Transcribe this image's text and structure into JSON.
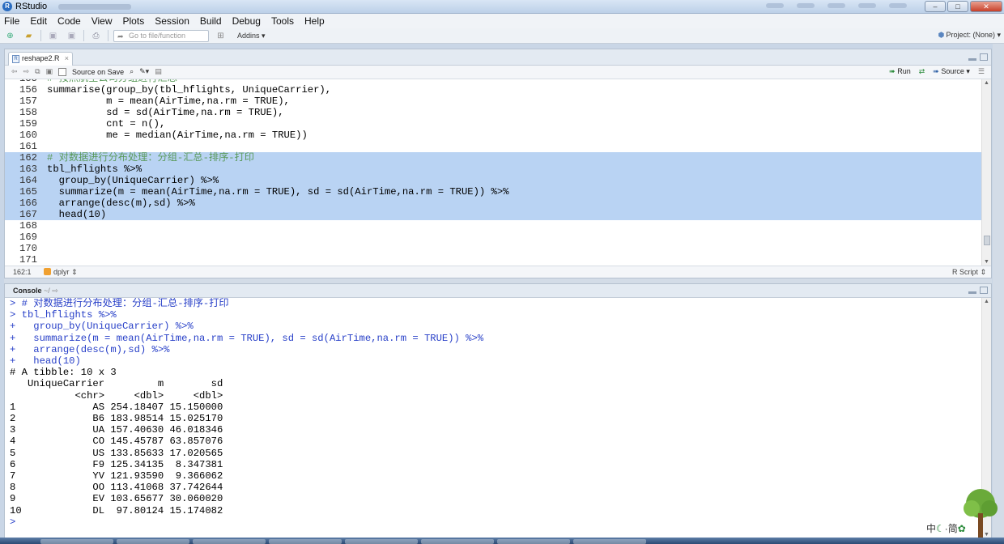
{
  "window": {
    "title": "RStudio"
  },
  "menu": [
    "File",
    "Edit",
    "Code",
    "View",
    "Plots",
    "Session",
    "Build",
    "Debug",
    "Tools",
    "Help"
  ],
  "toolbar": {
    "goto_placeholder": "Go to file/function",
    "addins": "Addins",
    "project": "Project: (None)"
  },
  "editor": {
    "tab": "reshape2.R",
    "source_on_save": "Source on Save",
    "run": "Run",
    "source": "Source",
    "lines": [
      {
        "n": "156",
        "t": "summarise(group_by(tbl_hflights, UniqueCarrier),",
        "sel": false
      },
      {
        "n": "157",
        "t": "          m = mean(AirTime,na.rm = TRUE),",
        "sel": false
      },
      {
        "n": "158",
        "t": "          sd = sd(AirTime,na.rm = TRUE),",
        "sel": false
      },
      {
        "n": "159",
        "t": "          cnt = n(),",
        "sel": false
      },
      {
        "n": "160",
        "t": "          me = median(AirTime,na.rm = TRUE))",
        "sel": false
      },
      {
        "n": "161",
        "t": "",
        "sel": false
      },
      {
        "n": "162",
        "t": "# 对数据进行分布处理：分组-汇总-排序-打印",
        "sel": true
      },
      {
        "n": "163",
        "t": "tbl_hflights %>%",
        "sel": true
      },
      {
        "n": "164",
        "t": "  group_by(UniqueCarrier) %>%",
        "sel": true
      },
      {
        "n": "165",
        "t": "  summarize(m = mean(AirTime,na.rm = TRUE), sd = sd(AirTime,na.rm = TRUE)) %>%",
        "sel": true
      },
      {
        "n": "166",
        "t": "  arrange(desc(m),sd) %>%",
        "sel": true
      },
      {
        "n": "167",
        "t": "  head(10)",
        "sel": true
      },
      {
        "n": "168",
        "t": "",
        "sel": false
      },
      {
        "n": "169",
        "t": "",
        "sel": false
      },
      {
        "n": "170",
        "t": "",
        "sel": false
      },
      {
        "n": "171",
        "t": "",
        "sel": false
      }
    ],
    "status_pos": "162:1",
    "status_fn": "dplyr",
    "status_type": "R Script"
  },
  "console": {
    "title": "Console",
    "path": "~/",
    "lines": [
      {
        "t": "> # 对数据进行分布处理：分组-汇总-排序-打印",
        "c": "in"
      },
      {
        "t": "> tbl_hflights %>%",
        "c": "in"
      },
      {
        "t": "+   group_by(UniqueCarrier) %>%",
        "c": "in"
      },
      {
        "t": "+   summarize(m = mean(AirTime,na.rm = TRUE), sd = sd(AirTime,na.rm = TRUE)) %>%",
        "c": "in"
      },
      {
        "t": "+   arrange(desc(m),sd) %>%",
        "c": "in"
      },
      {
        "t": "+   head(10)",
        "c": "in"
      },
      {
        "t": "# A tibble: 10 x 3",
        "c": "out"
      },
      {
        "t": "   UniqueCarrier         m        sd",
        "c": "out"
      },
      {
        "t": "           <chr>     <dbl>     <dbl>",
        "c": "out"
      },
      {
        "t": "1             AS 254.18407 15.150000",
        "c": "out"
      },
      {
        "t": "2             B6 183.98514 15.025170",
        "c": "out"
      },
      {
        "t": "3             UA 157.40630 46.018346",
        "c": "out"
      },
      {
        "t": "4             CO 145.45787 63.857076",
        "c": "out"
      },
      {
        "t": "5             US 133.85633 17.020565",
        "c": "out"
      },
      {
        "t": "6             F9 125.34135  8.347381",
        "c": "out"
      },
      {
        "t": "7             YV 121.93590  9.366062",
        "c": "out"
      },
      {
        "t": "8             OO 113.41068 37.742644",
        "c": "out"
      },
      {
        "t": "9             EV 103.65677 30.060020",
        "c": "out"
      },
      {
        "t": "10            DL  97.80124 15.174082",
        "c": "out"
      },
      {
        "t": "> ",
        "c": "in"
      }
    ]
  },
  "ime": {
    "label": "中",
    "simplified": "简"
  }
}
